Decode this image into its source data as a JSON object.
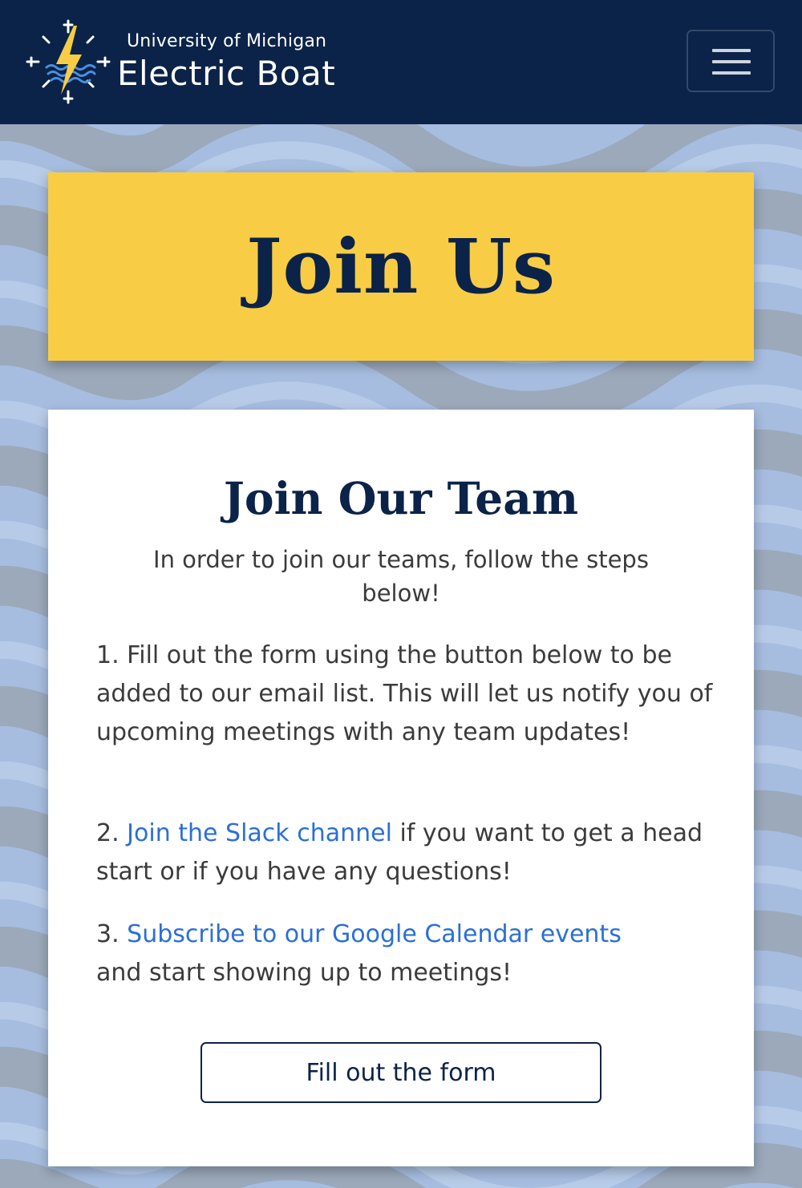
{
  "nav": {
    "brand_subtitle": "University of Michigan",
    "brand_title": "Electric Boat",
    "menu_icon": "hamburger-icon"
  },
  "banner": {
    "title": "Join Us"
  },
  "card": {
    "heading": "Join Our Team",
    "intro": "In order to join our teams, follow the steps below!",
    "steps": [
      {
        "number": "1.",
        "text": "Fill out the form using the button below to be added to our email list. This will let us notify you of upcoming meetings with any team updates!"
      },
      {
        "number": "2.",
        "link_text": "Join the Slack channel",
        "text": "if you want to get a head start or if you have any questions!"
      },
      {
        "number": "3.",
        "link_text": "Subscribe to our Google Calendar events",
        "text": "and start showing up to meetings!"
      }
    ],
    "button_label": "Fill out the form"
  },
  "colors": {
    "navy": "#0b2348",
    "maize": "#f8cd45",
    "link": "#2b6fd6",
    "background": "#a6bde0"
  }
}
